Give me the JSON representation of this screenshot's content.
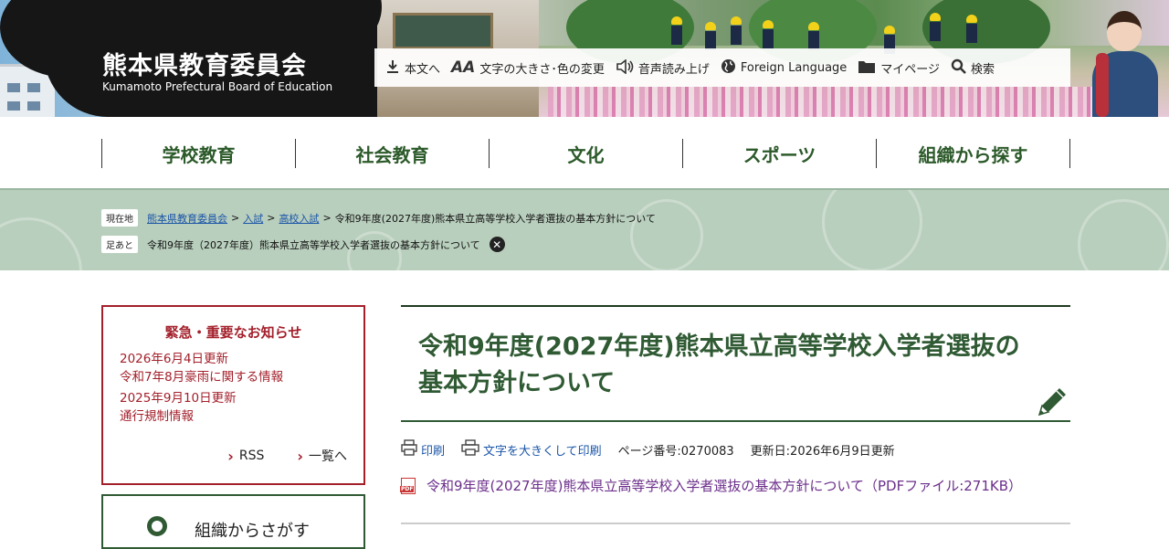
{
  "header": {
    "site_title": "熊本県教育委員会",
    "site_subtitle": "Kumamoto Prefectural Board of Education"
  },
  "utility_nav": [
    {
      "icon": "download-icon",
      "label": "本文へ"
    },
    {
      "icon": "font-size-icon",
      "label": "文字の大きさ･色の変更"
    },
    {
      "icon": "speaker-icon",
      "label": "音声読み上げ"
    },
    {
      "icon": "globe-icon",
      "label": "Foreign Language"
    },
    {
      "icon": "folder-icon",
      "label": "マイページ"
    },
    {
      "icon": "search-icon",
      "label": "検索"
    }
  ],
  "global_nav": [
    "学校教育",
    "社会教育",
    "文化",
    "スポーツ",
    "組織から探す"
  ],
  "breadcrumb": {
    "current_tag": "現在地",
    "links": [
      "熊本県教育委員会",
      "入試",
      "高校入試"
    ],
    "current": "令和9年度(2027年度)熊本県立高等学校入学者選抜の基本方針について",
    "footprint_tag": "足あと",
    "footprint_item": "令和9年度（2027年度）熊本県立高等学校入学者選抜の基本方針について"
  },
  "notice": {
    "title": "緊急・重要なお知らせ",
    "items": [
      {
        "date": "2026年6月4日更新",
        "text": "令和7年8月豪雨に関する情報"
      },
      {
        "date": "2025年9月10日更新",
        "text": "通行規制情報"
      }
    ],
    "rss_label": "RSS",
    "list_label": "一覧へ"
  },
  "org_search": {
    "label": "組織からさがす"
  },
  "main": {
    "title": "令和9年度(2027年度)熊本県立高等学校入学者選抜の基本方針について",
    "print_label": "印刷",
    "print_large_label": "文字を大きくして印刷",
    "page_number": "ページ番号:0270083",
    "updated": "更新日:2026年6月9日更新",
    "pdf_link": "令和9年度(2027年度)熊本県立高等学校入学者選抜の基本方針について（PDFファイル:271KB）"
  },
  "colors": {
    "brand_green": "#2f5a33",
    "alert_red": "#a3202b",
    "band_green": "#b9cfbd",
    "link_blue": "#1a55a8",
    "visited_purple": "#6b2e8a"
  }
}
